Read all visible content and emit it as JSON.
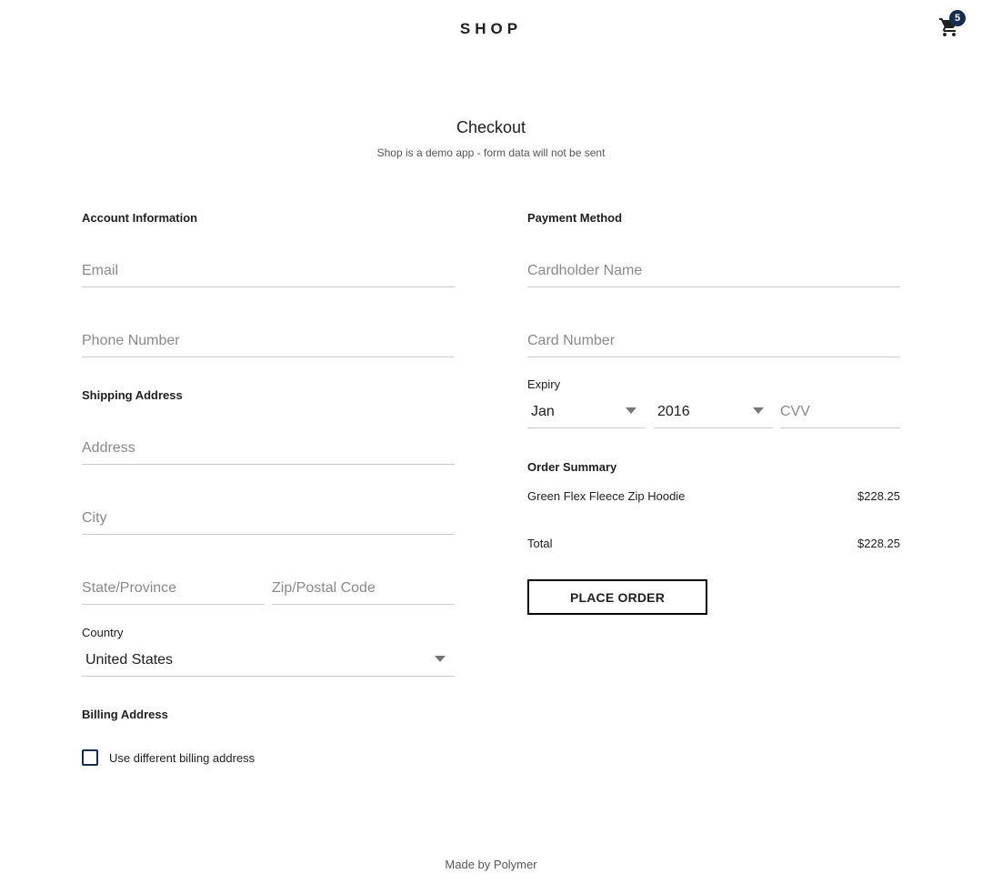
{
  "header": {
    "logo": "SHOP",
    "cart_count": "5",
    "cart_icon": "shopping-cart-icon"
  },
  "page": {
    "title": "Checkout",
    "subtitle": "Shop is a demo app - form data will not be sent"
  },
  "account": {
    "heading": "Account Information",
    "email_placeholder": "Email",
    "email_value": "",
    "phone_placeholder": "Phone Number",
    "phone_value": ""
  },
  "shipping": {
    "heading": "Shipping Address",
    "address_placeholder": "Address",
    "city_placeholder": "City",
    "state_placeholder": "State/Province",
    "zip_placeholder": "Zip/Postal Code",
    "country_label": "Country",
    "country_value": "United States"
  },
  "billing": {
    "heading": "Billing Address",
    "checkbox_label": "Use different billing address",
    "checked": false
  },
  "payment": {
    "heading": "Payment Method",
    "cardholder_placeholder": "Cardholder Name",
    "card_number_placeholder": "Card Number",
    "expiry_label": "Expiry",
    "expiry_month": "Jan",
    "expiry_year": "2016",
    "cvv_placeholder": "CVV"
  },
  "order_summary": {
    "heading": "Order Summary",
    "items": [
      {
        "name": "Green Flex Fleece Zip Hoodie",
        "price": "$228.25"
      }
    ],
    "total_label": "Total",
    "total_value": "$228.25",
    "place_order_label": "PLACE ORDER"
  },
  "footer": {
    "text": "Made by Polymer"
  },
  "colors": {
    "accent": "#172c50",
    "text": "#202020",
    "placeholder": "#8a8a8a",
    "divider": "#cccccc"
  }
}
